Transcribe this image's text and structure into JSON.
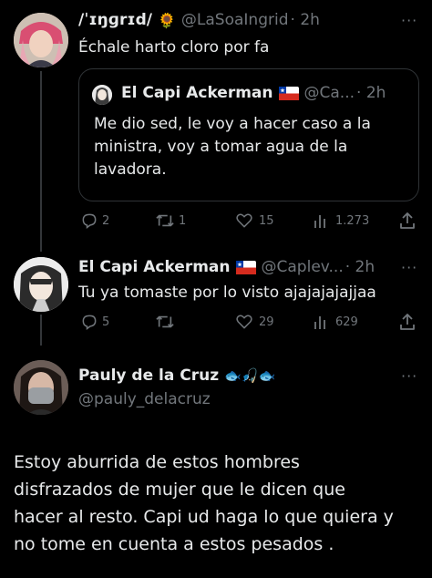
{
  "tweet1": {
    "display_name": "/ˈɪŋɡrɪd/",
    "emoji": "🌻",
    "handle": "@LaSoaIngrid",
    "time": "· 2h",
    "text": "Échale harto cloro por fa",
    "more": "···",
    "quote": {
      "display_name": "El Capi Ackerman",
      "handle": "@Ca...",
      "time": "· 2h",
      "text_lines": [
        "Me dio sed, le voy a hacer caso a la",
        "ministra, voy a tomar agua de la",
        "lavadora."
      ]
    },
    "actions": {
      "replies": "2",
      "retweets": "1",
      "likes": "15",
      "views": "1.273"
    }
  },
  "tweet2": {
    "display_name": "El Capi Ackerman",
    "handle": "@Caplev...",
    "time": "· 2h",
    "text": "Tu ya tomaste por lo visto ajajajajajjaa",
    "more": "···",
    "actions": {
      "replies": "5",
      "retweets": "",
      "likes": "29",
      "views": "629"
    }
  },
  "tweet3": {
    "display_name": "Pauly de la Cruz",
    "emoji": "🐟🎣🐟",
    "handle": "@pauly_delacruz",
    "more": "···",
    "text_lines": [
      "Estoy aburrida de estos hombres",
      "disfrazados de mujer que le dicen que",
      "hacer al resto. Capi ud haga lo que quiera y",
      "no tome en cuenta a estos pesados ."
    ]
  },
  "colors": {
    "background": "#000000",
    "text": "#e7e9ea",
    "muted": "#71767b",
    "border": "#2f3336"
  },
  "icons": [
    "reply-icon",
    "retweet-icon",
    "like-icon",
    "views-icon",
    "share-icon",
    "chile-flag-icon"
  ]
}
